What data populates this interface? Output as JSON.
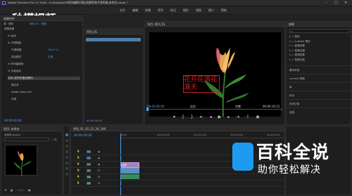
{
  "window": {
    "title": "Adobe Premiere Pro CC 2018 - E:\\Desktop\\PR如何编辑字幕出现颜色和不透明度\\未命名.prproj *"
  },
  "menu": [
    "文件",
    "编辑",
    "剪辑",
    "序列",
    "标记",
    "图形",
    "视图",
    "窗口",
    "帮助"
  ],
  "watermark_logo": "秒懂视频",
  "effect_controls": {
    "tab": "效果控件",
    "source_label": "源 · 图形",
    "sequence_label": "序列_01 · 图形",
    "rows": [
      {
        "label": "视频效果",
        "indent": 0
      },
      {
        "label": "fx  运动",
        "indent": 1
      },
      {
        "label": "fx  不透明度",
        "indent": 1
      },
      {
        "label": "不透明度",
        "value": "100.0 %",
        "indent": 2
      },
      {
        "label": "混合模式",
        "value": "正常",
        "indent": 2
      },
      {
        "label": "fx  时间重映射",
        "indent": 1
      },
      {
        "label": "fx  矢量运动",
        "indent": 1
      },
      {
        "label": "文本 (花开花落花满天)",
        "indent": 1,
        "selected": true
      },
      {
        "label": "源文本",
        "indent": 2
      },
      {
        "label": "Adobe Song Std",
        "indent": 2
      },
      {
        "label": "外观",
        "indent": 2
      }
    ],
    "timecode": "00:00:00:00"
  },
  "media_panel": {
    "tab": "序列_01",
    "timecode": "00:00:00:00"
  },
  "program_monitor": {
    "tab": "节目: 序列_01",
    "caption_text": "花开花落花满天",
    "current_time": "00:00:00:00",
    "fit_label": "适合",
    "quality_label": "完整",
    "duration": "00:00:10:21"
  },
  "effects_panel": {
    "tab": "效果",
    "items": [
      "预设",
      "Lumetri 预设",
      "音频效果",
      "音频过渡",
      "视频效果",
      "视频过渡"
    ],
    "sections": [
      "基本声音",
      "Lumetri 颜色",
      "库",
      "标记",
      "历史记录",
      "信息"
    ]
  },
  "project_panel": {
    "tab": "项目: 未命名",
    "file": "未命名.prproj",
    "item_count": "1 项"
  },
  "timeline": {
    "tab": "序列_01_02_22_34_346",
    "timecode": "00:00:00:00",
    "ruler": [
      "00:00",
      "00:00:05:00",
      "00:00:10:00",
      "00:00:15:00",
      "00:00:20:00"
    ],
    "tracks": [
      "V3",
      "V2",
      "V1",
      "A1",
      "A2",
      "A3"
    ],
    "clip_label": "图形"
  },
  "baidu_watermark": {
    "title": "百科全说",
    "subtitle": "助你轻松解决"
  }
}
